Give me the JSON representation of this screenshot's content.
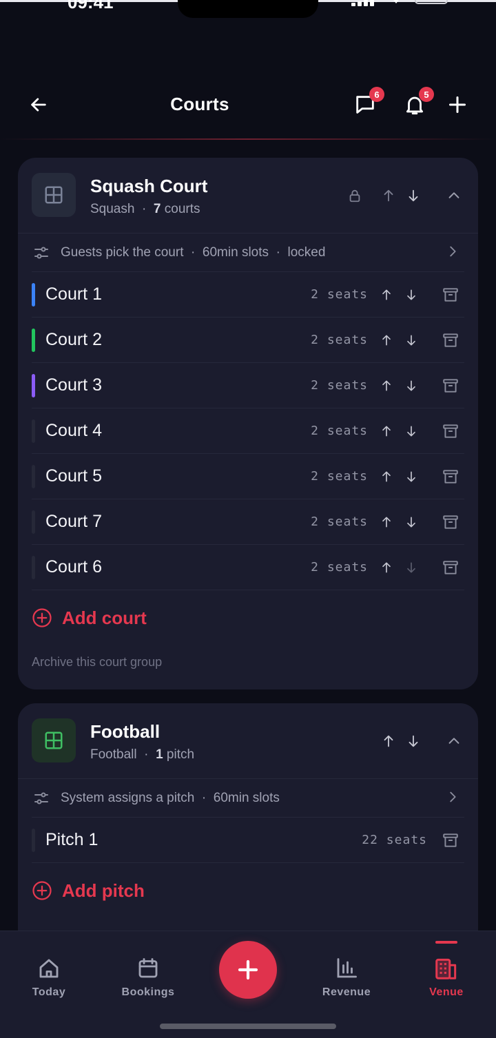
{
  "status_bar": {
    "time": "09:41"
  },
  "header": {
    "title": "Courts",
    "messages_badge": "6",
    "notifications_badge": "5"
  },
  "groups": [
    {
      "name": "Squash Court",
      "sport": "Squash",
      "count": "7",
      "count_unit": "courts",
      "locked": true,
      "settings": [
        "Guests pick the court",
        "60min slots",
        "locked"
      ],
      "items": [
        {
          "name": "Court 1",
          "seats": "2 seats",
          "color": "#3b82f6"
        },
        {
          "name": "Court 2",
          "seats": "2 seats",
          "color": "#22c55e"
        },
        {
          "name": "Court 3",
          "seats": "2 seats",
          "color": "#8b5cf6"
        },
        {
          "name": "Court 4",
          "seats": "2 seats",
          "color": ""
        },
        {
          "name": "Court 5",
          "seats": "2 seats",
          "color": ""
        },
        {
          "name": "Court 7",
          "seats": "2 seats",
          "color": ""
        },
        {
          "name": "Court 6",
          "seats": "2 seats",
          "color": ""
        }
      ],
      "add_label": "Add court",
      "archive_label": "Archive this court group"
    },
    {
      "name": "Football",
      "sport": "Football",
      "count": "1",
      "count_unit": "pitch",
      "locked": false,
      "settings": [
        "System assigns a pitch",
        "60min slots"
      ],
      "items": [
        {
          "name": "Pitch 1",
          "seats": "22 seats",
          "color": ""
        }
      ],
      "add_label": "Add pitch"
    }
  ],
  "bottom_nav": {
    "items": [
      {
        "label": "Today",
        "icon": "home-icon"
      },
      {
        "label": "Bookings",
        "icon": "calendar-icon"
      },
      {
        "label": "Revenue",
        "icon": "bar-chart-icon"
      },
      {
        "label": "Venue",
        "icon": "building-icon",
        "active": true
      }
    ]
  },
  "colors": {
    "accent": "#e5384f",
    "background": "#0c0d17",
    "card": "#1b1c2e"
  }
}
